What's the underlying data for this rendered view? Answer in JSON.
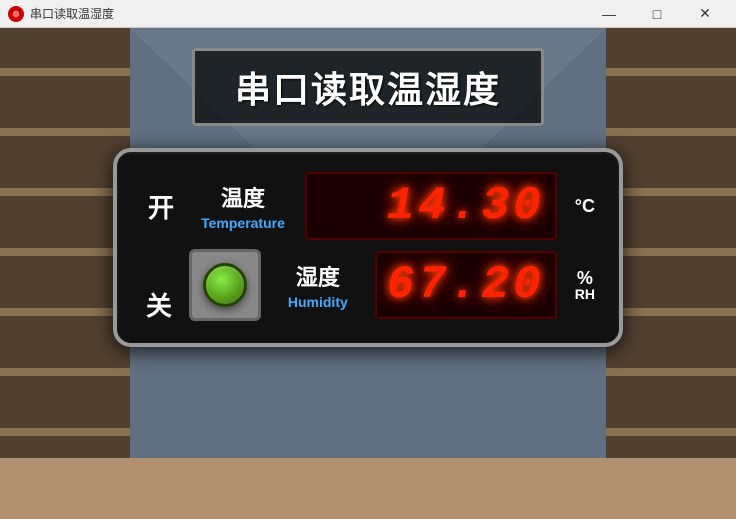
{
  "window": {
    "title": "串口读取温湿度",
    "controls": {
      "minimize": "—",
      "maximize": "□",
      "close": "✕"
    }
  },
  "main_title": "串口读取温湿度",
  "panel": {
    "status_on": "开",
    "status_off": "关",
    "temperature": {
      "chinese": "温度",
      "english": "Temperature",
      "value": "14.30",
      "unit_top": "°C",
      "unit_bottom": ""
    },
    "humidity": {
      "chinese": "湿度",
      "english": "Humidity",
      "value": "67.20",
      "unit_top": "%",
      "unit_bottom": "RH"
    }
  },
  "colors": {
    "led_red": "#ff2200",
    "led_bg": "#1a0000",
    "panel_bg": "#111111",
    "title_text": "#ffffff",
    "english_label": "#44aaff"
  }
}
